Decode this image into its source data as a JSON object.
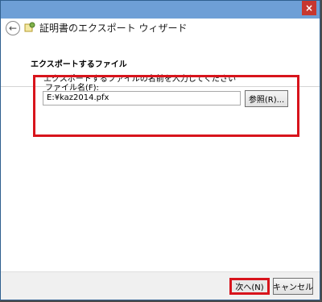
{
  "window": {
    "title": "証明書のエクスポート ウィザード",
    "close_glyph": "×",
    "back_glyph": "←"
  },
  "page": {
    "heading": "エクスポートするファイル",
    "description": "エクスポートするファイルの名前を入力してください"
  },
  "file": {
    "label": "ファイル名(F):",
    "value": "E:¥kaz2014.pfx",
    "browse_label": "参照(R)..."
  },
  "buttons": {
    "next_label": "次へ(N)",
    "cancel_label": "キャンセル"
  },
  "colors": {
    "accent_frame": "#6e9fd6",
    "highlight": "#d8141c"
  },
  "icons": {
    "wizard": "certificate-wizard-icon",
    "back": "back-arrow-icon",
    "close": "close-icon"
  }
}
